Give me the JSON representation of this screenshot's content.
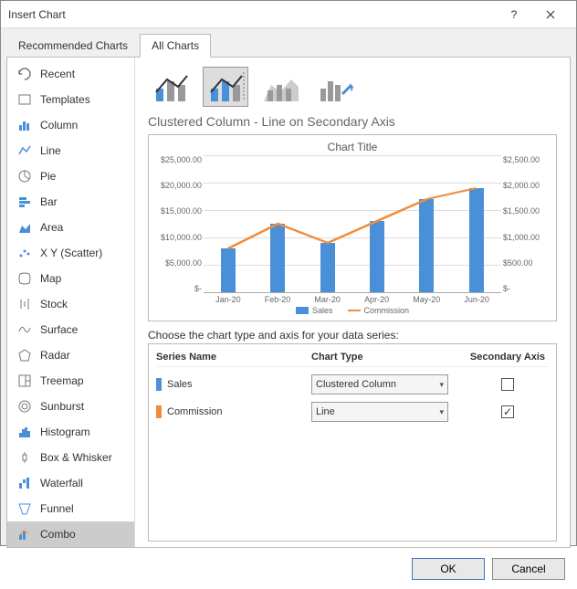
{
  "dialog_title": "Insert Chart",
  "tabs": {
    "recommended": "Recommended Charts",
    "all": "All Charts"
  },
  "sidebar": {
    "items": [
      {
        "label": "Recent"
      },
      {
        "label": "Templates"
      },
      {
        "label": "Column"
      },
      {
        "label": "Line"
      },
      {
        "label": "Pie"
      },
      {
        "label": "Bar"
      },
      {
        "label": "Area"
      },
      {
        "label": "X Y (Scatter)"
      },
      {
        "label": "Map"
      },
      {
        "label": "Stock"
      },
      {
        "label": "Surface"
      },
      {
        "label": "Radar"
      },
      {
        "label": "Treemap"
      },
      {
        "label": "Sunburst"
      },
      {
        "label": "Histogram"
      },
      {
        "label": "Box & Whisker"
      },
      {
        "label": "Waterfall"
      },
      {
        "label": "Funnel"
      },
      {
        "label": "Combo"
      }
    ]
  },
  "subtype_heading": "Clustered Column - Line on Secondary Axis",
  "config": {
    "heading": "Choose the chart type and axis for your data series:",
    "col_series": "Series Name",
    "col_type": "Chart Type",
    "col_axis": "Secondary Axis",
    "rows": [
      {
        "name": "Sales",
        "type": "Clustered Column",
        "secondary": false,
        "color": "#4a90d9"
      },
      {
        "name": "Commission",
        "type": "Line",
        "secondary": true,
        "color": "#f08c3c"
      }
    ]
  },
  "buttons": {
    "ok": "OK",
    "cancel": "Cancel"
  },
  "chart_data": {
    "type": "combo",
    "title": "Chart Title",
    "categories": [
      "Jan-20",
      "Feb-20",
      "Mar-20",
      "Apr-20",
      "May-20",
      "Jun-20"
    ],
    "series": [
      {
        "name": "Sales",
        "type": "bar",
        "axis": "primary",
        "values": [
          8000,
          12500,
          9000,
          13000,
          17000,
          19000
        ]
      },
      {
        "name": "Commission",
        "type": "line",
        "axis": "secondary",
        "values": [
          800,
          1250,
          900,
          1300,
          1700,
          1900
        ]
      }
    ],
    "y_axis": {
      "ticks": [
        "$25,000.00",
        "$20,000.00",
        "$15,000.00",
        "$10,000.00",
        "$5,000.00",
        "$-"
      ],
      "min": 0,
      "max": 25000
    },
    "y2_axis": {
      "ticks": [
        "$2,500.00",
        "$2,000.00",
        "$1,500.00",
        "$1,000.00",
        "$500.00",
        "$-"
      ],
      "min": 0,
      "max": 2500
    },
    "legend": [
      "Sales",
      "Commission"
    ]
  }
}
